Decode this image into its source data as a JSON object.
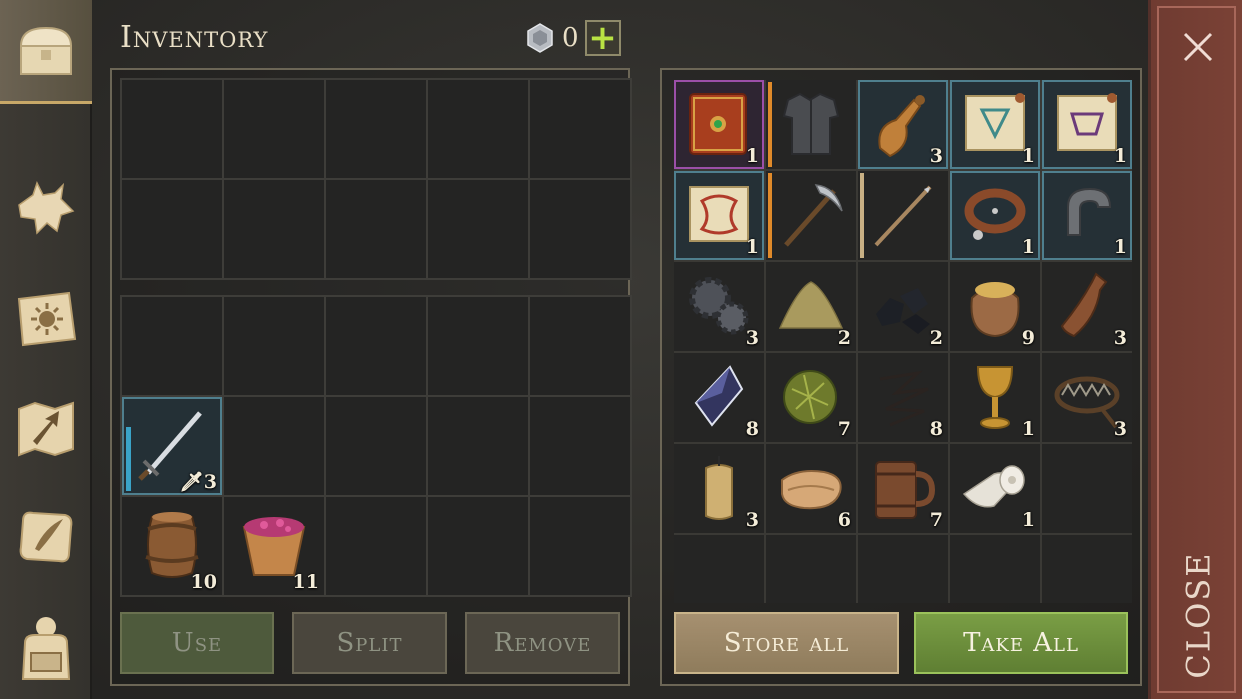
{
  "header": {
    "title": "Inventory",
    "currency_value": "0",
    "plus_label": "+"
  },
  "sidebar": {
    "tabs": [
      {
        "name": "chest-icon"
      },
      {
        "name": "wolf-icon"
      },
      {
        "name": "sun-book-icon"
      },
      {
        "name": "map-arrow-icon"
      },
      {
        "name": "scroll-quill-icon"
      },
      {
        "name": "character-backpack-icon"
      }
    ]
  },
  "inventory": {
    "sword_qty": "3",
    "barrel_qty": "10",
    "berries_qty": "11"
  },
  "chest": {
    "items": [
      {
        "name": "book",
        "qty": "1"
      },
      {
        "name": "chainmail-armor",
        "qty": ""
      },
      {
        "name": "bell",
        "qty": "3"
      },
      {
        "name": "blue-scroll",
        "qty": "1"
      },
      {
        "name": "purple-scroll",
        "qty": "1"
      },
      {
        "name": "red-scroll",
        "qty": "1"
      },
      {
        "name": "pickaxe",
        "qty": ""
      },
      {
        "name": "spear",
        "qty": ""
      },
      {
        "name": "collar",
        "qty": "1"
      },
      {
        "name": "metal-clamp",
        "qty": "1"
      },
      {
        "name": "gears",
        "qty": "3"
      },
      {
        "name": "sand-pile",
        "qty": "2"
      },
      {
        "name": "coal",
        "qty": "2"
      },
      {
        "name": "grain-sack",
        "qty": "9"
      },
      {
        "name": "bottle",
        "qty": "3"
      },
      {
        "name": "crystal",
        "qty": "8"
      },
      {
        "name": "herb-ball",
        "qty": "7"
      },
      {
        "name": "wire",
        "qty": "8"
      },
      {
        "name": "goblet",
        "qty": "1"
      },
      {
        "name": "bear-trap",
        "qty": "3"
      },
      {
        "name": "candle",
        "qty": "3"
      },
      {
        "name": "cloth",
        "qty": "6"
      },
      {
        "name": "mug",
        "qty": "7"
      },
      {
        "name": "bandage-roll",
        "qty": "1"
      }
    ]
  },
  "buttons": {
    "use": "Use",
    "split": "Split",
    "remove": "Remove",
    "store_all": "Store all",
    "take_all": "Take All"
  },
  "close": {
    "label": "CLOSE"
  },
  "colors": {
    "accent_green": "#b9e243",
    "take_all_green": "#6f9340",
    "close_red": "#74402f",
    "blue_rarity": "#4f7f8e",
    "purple_rarity": "#9b4fa8",
    "orange_rarity": "#d1893b"
  }
}
